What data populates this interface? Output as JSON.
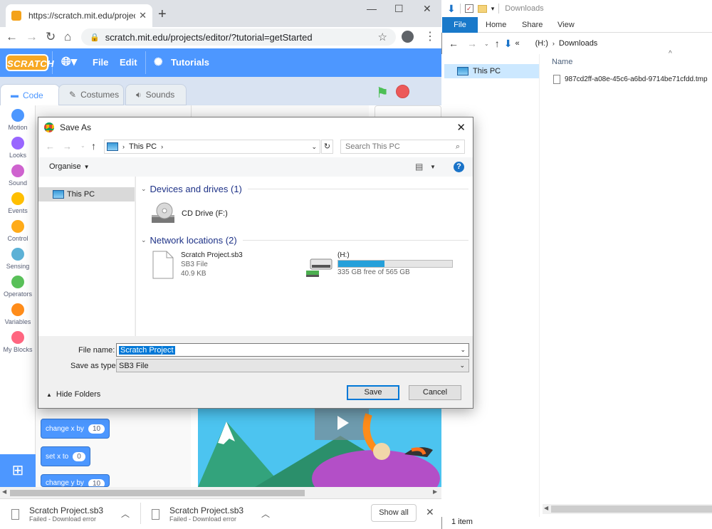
{
  "browser": {
    "tab_title": "https://scratch.mit.edu/projects/e",
    "url": "scratch.mit.edu/projects/editor/?tutorial=getStarted"
  },
  "scratch": {
    "logo_text": "SCRATCH",
    "menu": {
      "file": "File",
      "edit": "Edit",
      "tutorials": "Tutorials"
    },
    "tabs": {
      "code": "Code",
      "costumes": "Costumes",
      "sounds": "Sounds"
    },
    "categories": [
      {
        "label": "Motion",
        "color": "#4c97ff"
      },
      {
        "label": "Looks",
        "color": "#9966ff"
      },
      {
        "label": "Sound",
        "color": "#cf63cf"
      },
      {
        "label": "Events",
        "color": "#ffbf00"
      },
      {
        "label": "Control",
        "color": "#ffab19"
      },
      {
        "label": "Sensing",
        "color": "#5cb1d6"
      },
      {
        "label": "Operators",
        "color": "#59c059"
      },
      {
        "label": "Variables",
        "color": "#ff8c1a"
      },
      {
        "label": "My Blocks",
        "color": "#ff6680"
      }
    ],
    "blocks": [
      {
        "label": "change x by",
        "value": "10"
      },
      {
        "label": "set x to",
        "value": "0"
      },
      {
        "label": "change y by",
        "value": "10"
      }
    ]
  },
  "downloads": {
    "items": [
      {
        "name": "Scratch Project.sb3",
        "status": "Failed - Download error"
      },
      {
        "name": "Scratch Project.sb3",
        "status": "Failed - Download error"
      }
    ],
    "show_all": "Show all"
  },
  "explorer": {
    "title": "Downloads",
    "ribbon": {
      "file": "File",
      "home": "Home",
      "share": "Share",
      "view": "View"
    },
    "address": {
      "prefix": "«",
      "drive": "(H:)",
      "folder": "Downloads"
    },
    "nav_this_pc": "This PC",
    "column_name": "Name",
    "file": "987cd2ff-a08e-45c6-a6bd-9714be71cfdd.tmp",
    "status": "1 item"
  },
  "dialog": {
    "title": "Save As",
    "path": "This PC",
    "search_placeholder": "Search This PC",
    "organise": "Organise",
    "nav_this_pc": "This PC",
    "group_devices": "Devices and drives (1)",
    "cd_drive": "CD Drive (F:)",
    "group_network": "Network locations (2)",
    "file_item": {
      "name": "Scratch Project.sb3",
      "type": "SB3 File",
      "size": "40.9 KB"
    },
    "drive_item": {
      "name": "(H:)",
      "free": "335 GB free of 565 GB",
      "used_fraction": 0.407
    },
    "file_name_label": "File name:",
    "file_name_value": "Scratch Project",
    "save_as_type_label": "Save as type:",
    "save_as_type_value": "SB3 File",
    "hide_folders": "Hide Folders",
    "save": "Save",
    "cancel": "Cancel"
  }
}
